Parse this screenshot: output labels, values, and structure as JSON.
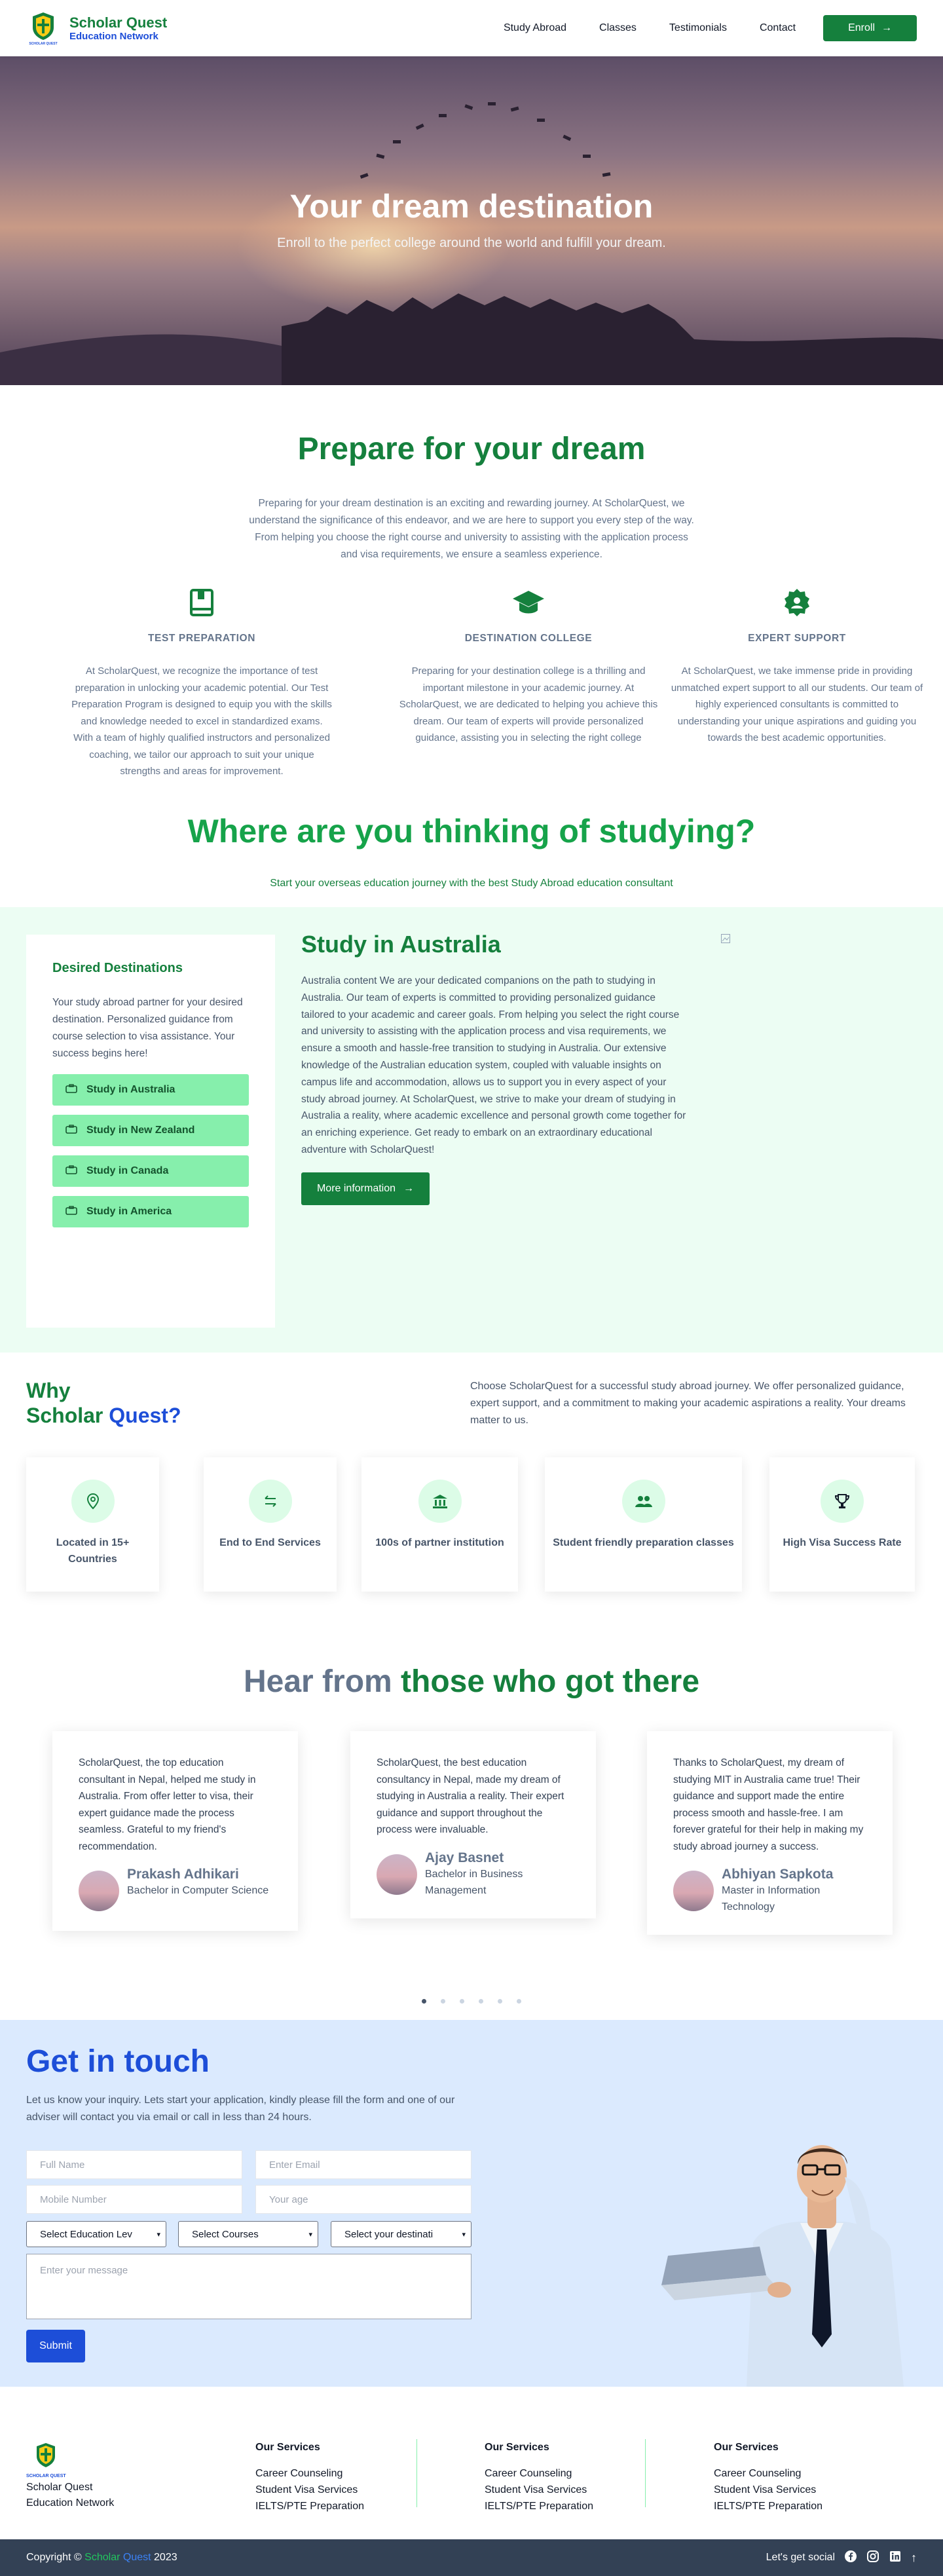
{
  "nav": {
    "brand_title": "Scholar Quest",
    "brand_sub": "Education Network",
    "logo_text": "SCHOLAR QUEST",
    "links": [
      "Study Abroad",
      "Classes",
      "Testimonials",
      "Contact"
    ],
    "enroll_label": "Enroll"
  },
  "hero": {
    "title": "Your dream destination",
    "subtitle": "Enroll to the perfect college around the world and fulfill your dream."
  },
  "prepare": {
    "title": "Prepare for your dream",
    "description": "Preparing for your dream destination is an exciting and rewarding journey. At ScholarQuest, we understand the significance of this endeavor, and we are here to support you every step of the way. From helping you choose the right course and university to assisting with the application process and visa requirements, we ensure a seamless experience.",
    "features": [
      {
        "icon": "book-icon",
        "heading": "TEST PREPARATION",
        "text": "At ScholarQuest, we recognize the importance of test preparation in unlocking your academic potential. Our Test Preparation Program is designed to equip you with the skills and knowledge needed to excel in standardized exams. With a team of highly qualified instructors and personalized coaching, we tailor our approach to suit your unique strengths and areas for improvement."
      },
      {
        "icon": "graduation-cap-icon",
        "heading": "DESTINATION COLLEGE",
        "text": "Preparing for your destination college is a thrilling and important milestone in your academic journey. At ScholarQuest, we are dedicated to helping you achieve this dream. Our team of experts will provide personalized guidance, assisting you in selecting the right college"
      },
      {
        "icon": "expert-badge-icon",
        "heading": "EXPERT SUPPORT",
        "text": "At ScholarQuest, we take immense pride in providing unmatched expert support to all our students. Our team of highly experienced consultants is committed to understanding your unique aspirations and guiding you towards the best academic opportunities."
      }
    ]
  },
  "where": {
    "title": "Where are you thinking of studying?",
    "subtitle": "Start your overseas education journey with the best Study Abroad education consultant"
  },
  "destinations": {
    "title": "Desired Destinations",
    "description": "Your study abroad partner for your desired destination. Personalized guidance from course selection to visa assistance. Your success begins here!",
    "buttons": [
      "Study in Australia",
      "Study in New Zealand",
      "Study in Canada",
      "Study in America"
    ]
  },
  "australia": {
    "title": "Study in Australia",
    "text": "Australia content We are your dedicated companions on the path to studying in Australia. Our team of experts is committed to providing personalized guidance tailored to your academic and career goals. From helping you select the right course and university to assisting with the application process and visa requirements, we ensure a smooth and hassle-free transition to studying in Australia. Our extensive knowledge of the Australian education system, coupled with valuable insights on campus life and accommodation, allows us to support you in every aspect of your study abroad journey. At ScholarQuest, we strive to make your dream of studying in Australia a reality, where academic excellence and personal growth come together for an enriching experience. Get ready to embark on an extraordinary educational adventure with ScholarQuest!",
    "more_label": "More information"
  },
  "why": {
    "title_line1": "Why",
    "title_scholar": "Scholar",
    "title_quest": "Quest?",
    "description": "Choose ScholarQuest for a successful study abroad journey. We offer personalized guidance, expert support, and a commitment to making your academic aspirations a reality. Your dreams matter to us.",
    "cards": [
      {
        "icon": "location-pin-icon",
        "label": "Located in 15+ Countries"
      },
      {
        "icon": "arrows-exchange-icon",
        "label": "End to End Services"
      },
      {
        "icon": "institution-icon",
        "label": "100s of partner institution"
      },
      {
        "icon": "users-icon",
        "label": "Student friendly preparation classes"
      },
      {
        "icon": "visa-trophy-icon",
        "label": "High Visa Success Rate"
      }
    ]
  },
  "testimonials": {
    "title_grey": "Hear from",
    "title_green": "those who got there",
    "items": [
      {
        "text": "ScholarQuest, the top education consultant in Nepal, helped me study in Australia. From offer letter to visa, their expert guidance made the process seamless. Grateful to my friend's recommendation.",
        "name": "Prakash Adhikari",
        "role": "Bachelor in Computer Science"
      },
      {
        "text": "ScholarQuest, the best education consultancy in Nepal, made my dream of studying in Australia a reality. Their expert guidance and support throughout the process were invaluable.",
        "name": "Ajay Basnet",
        "role": "Bachelor in Business Management"
      },
      {
        "text": "Thanks to ScholarQuest, my dream of studying MIT in Australia came true! Their guidance and support made the entire process smooth and hassle-free. I am forever grateful for their help in making my study abroad journey a success.",
        "name": "Abhiyan Sapkota",
        "role": "Master in Information Technology"
      }
    ],
    "active_dot": 0,
    "dot_count": 6
  },
  "contact": {
    "title": "Get in touch",
    "description": "Let us know your inquiry. Lets start your application, kindly please fill the form and one of our adviser will contact you via email or call in less than 24 hours.",
    "placeholders": {
      "full_name": "Full Name",
      "email": "Enter Email",
      "mobile": "Mobile Number",
      "age": "Your age",
      "message": "Enter your message"
    },
    "selects": [
      "Select Education Lev",
      "Select Courses",
      "Select your destinati"
    ],
    "submit_label": "Submit"
  },
  "footer": {
    "logo_text": "SCHOLAR QUEST",
    "name_line1": "Scholar Quest",
    "name_line2": "Education Network",
    "columns": [
      {
        "heading": "Our Services",
        "items": [
          "Career Counseling",
          "Student Visa Services",
          "IELTS/PTE Preparation"
        ]
      },
      {
        "heading": "Our Services",
        "items": [
          "Career Counseling",
          "Student Visa Services",
          "IELTS/PTE Preparation"
        ]
      },
      {
        "heading": "Our Services",
        "items": [
          "Career Counseling",
          "Student Visa Services",
          "IELTS/PTE Preparation"
        ]
      }
    ],
    "copyright_prefix": "Copyright ©",
    "copyright_scholar": "Scholar",
    "copyright_quest": "Quest",
    "copyright_year": "2023",
    "social_label": "Let's get social",
    "social_icons": [
      "facebook-icon",
      "instagram-icon",
      "linkedin-icon",
      "arrow-up-icon"
    ]
  },
  "colors": {
    "green": "#15803d",
    "blue": "#1d4ed8",
    "mint_bg": "#ecfdf3",
    "contact_bg": "#dbeafe",
    "footer_bar": "#334155"
  }
}
